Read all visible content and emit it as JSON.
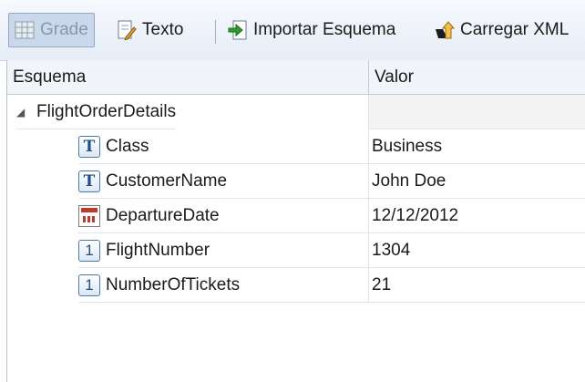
{
  "toolbar": {
    "grid_label": "Grade",
    "text_label": "Texto",
    "import_label": "Importar Esquema",
    "load_label": "Carregar XML"
  },
  "table": {
    "col_schema": "Esquema",
    "col_value": "Valor",
    "root": {
      "name": "FlightOrderDetails",
      "value": ""
    },
    "rows": [
      {
        "name": "Class",
        "value": "Business",
        "type": "text-icon"
      },
      {
        "name": "CustomerName",
        "value": "John Doe",
        "type": "text-icon"
      },
      {
        "name": "DepartureDate",
        "value": "12/12/2012",
        "type": "calendar-icon"
      },
      {
        "name": "FlightNumber",
        "value": "1304",
        "type": "number-icon"
      },
      {
        "name": "NumberOfTickets",
        "value": "21",
        "type": "number-icon"
      }
    ]
  }
}
